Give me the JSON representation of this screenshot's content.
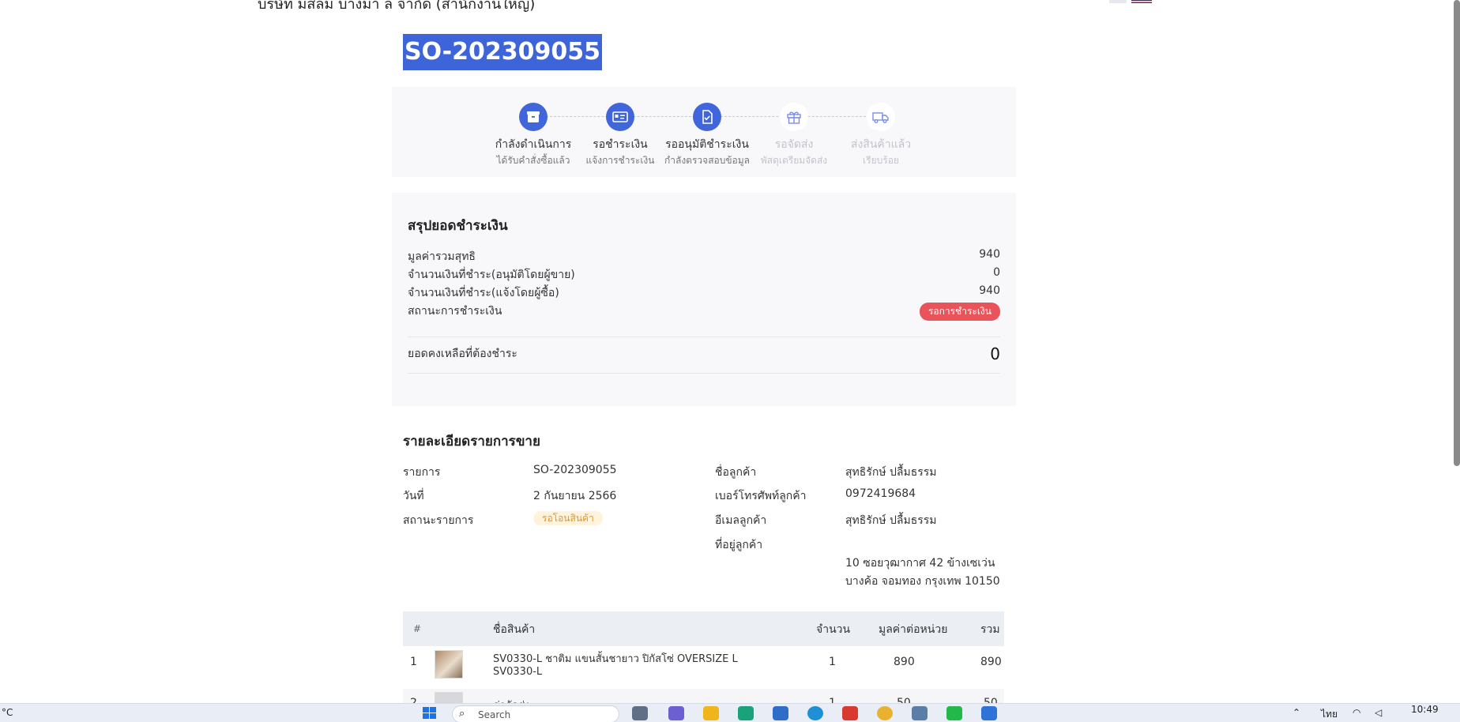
{
  "header": {
    "company_cut": "บริษัท มีสลิม บางมา ล จำกัด (สำนักงานใหญ่)"
  },
  "order": {
    "number": "SO-202309055"
  },
  "steps": [
    {
      "title": "กำลังดำเนินการ",
      "sub": "ได้รับคำสั่งซื้อแล้ว",
      "icon": "box-icon",
      "active": true
    },
    {
      "title": "รอชำระเงิน",
      "sub": "แจ้งการชำระเงิน",
      "icon": "payment-card-icon",
      "active": true
    },
    {
      "title": "รออนุมัติชำระเงิน",
      "sub": "กำลังตรวจสอบข้อมูล",
      "icon": "document-check-icon",
      "active": true
    },
    {
      "title": "รอจัดส่ง",
      "sub": "พัสดุเตรียมจัดส่ง",
      "icon": "gift-box-icon",
      "active": false
    },
    {
      "title": "ส่งสินค้าแล้ว",
      "sub": "เรียบร้อย",
      "icon": "truck-icon",
      "active": false
    }
  ],
  "payment": {
    "title": "สรุปยอดชำระเงิน",
    "rows": [
      {
        "label": "มูลค่ารวมสุทธิ",
        "value": "940"
      },
      {
        "label": "จำนวนเงินที่ชำระ(อนุมัติโดยผู้ขาย)",
        "value": "0"
      },
      {
        "label": "จำนวนเงินที่ชำระ(แจ้งโดยผู้ซื้อ)",
        "value": "940"
      }
    ],
    "status_label": "สถานะการชำระเงิน",
    "status_badge": "รอการชำระเงิน",
    "remaining_label": "ยอดคงเหลือที่ต้องชำระ",
    "remaining_value": "0",
    "colors": {
      "badge": "#e9545b"
    }
  },
  "details": {
    "title": "รายละเอียดรายการขาย",
    "item_label": "รายการ",
    "item_value": "SO-202309055",
    "date_label": "วันที่",
    "date_value": "2 กันยายน 2566",
    "status_label": "สถานะรายการ",
    "status_badge": "รอโอนสินค้า",
    "customer_label": "ชื่อลูกค้า",
    "customer_value": "สุทธิรักษ์ ปลื้มธรรม",
    "phone_label": "เบอร์โทรศัพท์ลูกค้า",
    "phone_value": "0972419684",
    "email_label": "อีเมลลูกค้า",
    "email_value": "สุทธิรักษ์ ปลื้มธรรม",
    "address_label": "ที่อยู่ลูกค้า",
    "address_line1": "10 ซอยวุฒากาศ 42 ข้างเซเว่น",
    "address_line2": "บางค้อ จอมทอง กรุงเทพ 10150"
  },
  "table": {
    "headers": {
      "num": "#",
      "name": "ชื่อสินค้า",
      "qty": "จำนวน",
      "unit": "มูลค่าต่อหน่วย",
      "total": "รวม"
    },
    "rows": [
      {
        "num": "1",
        "name1": "SV0330-L ชาติม แขนสั้นชายาว ปิกัสโซ่ OVERSIZE L",
        "name2": "SV0330-L",
        "qty": "1",
        "unit": "890",
        "total": "890"
      },
      {
        "num": "2",
        "name1": "ค่าจัดส่ง",
        "name2": "",
        "qty": "1",
        "unit": "50",
        "total": "50"
      }
    ]
  },
  "taskbar": {
    "temp": "°C",
    "search_placeholder": "Search",
    "lang": "ไทย",
    "clock": "10:49"
  }
}
